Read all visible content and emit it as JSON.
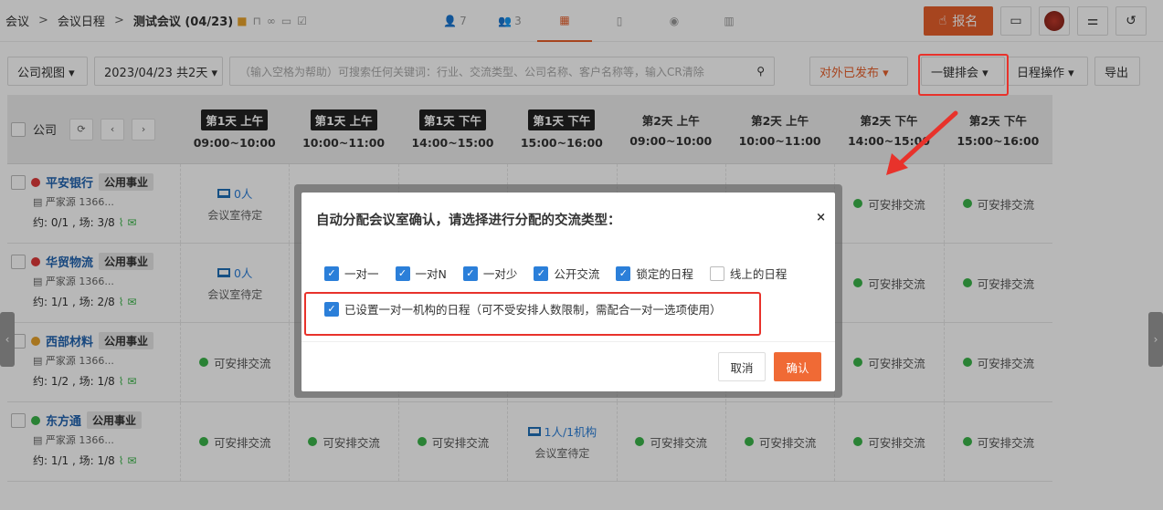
{
  "breadcrumb": {
    "items": [
      "会议",
      "会议日程",
      "测试会议 (04/23)"
    ]
  },
  "nav_tabs": [
    {
      "icon": "person-icon",
      "count": "7"
    },
    {
      "icon": "group-icon",
      "count": "3"
    },
    {
      "icon": "calendar-icon",
      "count": ""
    },
    {
      "icon": "document-icon",
      "count": ""
    },
    {
      "icon": "location-icon",
      "count": ""
    },
    {
      "icon": "chart-icon",
      "count": ""
    }
  ],
  "header": {
    "signup_label": "报名"
  },
  "filters": {
    "company_view": "公司视图 ▾",
    "date_range": "2023/04/23 共2天 ▾",
    "search_placeholder": "（输入空格为帮助）可搜索任何关键词：行业、交流类型、公司名称、客户名称等，输入CR清除",
    "published": "对外已发布 ▾",
    "auto_arrange": "一键排会 ▾",
    "schedule_ops": "日程操作 ▾",
    "export": "导出"
  },
  "grid": {
    "company_header": "公司",
    "slots": [
      {
        "day": "第1天 上午",
        "time": "09:00~10:00",
        "dark": true
      },
      {
        "day": "第1天 上午",
        "time": "10:00~11:00",
        "dark": true
      },
      {
        "day": "第1天 下午",
        "time": "14:00~15:00",
        "dark": true
      },
      {
        "day": "第1天 下午",
        "time": "15:00~16:00",
        "dark": true
      },
      {
        "day": "第2天 上午",
        "time": "09:00~10:00",
        "dark": false
      },
      {
        "day": "第2天 上午",
        "time": "10:00~11:00",
        "dark": false
      },
      {
        "day": "第2天 下午",
        "time": "14:00~15:00",
        "dark": false
      },
      {
        "day": "第2天 下午",
        "time": "15:00~16:00",
        "dark": false
      }
    ],
    "rows": [
      {
        "name": "平安银行",
        "tag": "公用事业",
        "contact": "严家源 1366...",
        "stats": "约: 0/1 , 场: 3/8",
        "status_color": "#e03a3a",
        "cells": [
          {
            "kind": "room",
            "top": "0人",
            "sub": "会议室待定"
          },
          {
            "kind": "blank"
          },
          {
            "kind": "blank"
          },
          {
            "kind": "blank"
          },
          {
            "kind": "blank"
          },
          {
            "kind": "blank"
          },
          {
            "kind": "avail",
            "text": "可安排交流"
          },
          {
            "kind": "avail",
            "text": "可安排交流"
          }
        ]
      },
      {
        "name": "华贸物流",
        "tag": "公用事业",
        "contact": "严家源 1366...",
        "stats": "约: 1/1 , 场: 2/8",
        "status_color": "#e03a3a",
        "cells": [
          {
            "kind": "room",
            "top": "0人",
            "sub": "会议室待定"
          },
          {
            "kind": "blank"
          },
          {
            "kind": "blank"
          },
          {
            "kind": "blank"
          },
          {
            "kind": "blank"
          },
          {
            "kind": "blank"
          },
          {
            "kind": "avail",
            "text": "可安排交流"
          },
          {
            "kind": "avail",
            "text": "可安排交流"
          }
        ]
      },
      {
        "name": "西部材料",
        "tag": "公用事业",
        "contact": "严家源 1366...",
        "stats": "约: 1/2 , 场: 1/8",
        "status_color": "#e8a32c",
        "cells": [
          {
            "kind": "avail",
            "text": "可安排交流"
          },
          {
            "kind": "blank"
          },
          {
            "kind": "blank"
          },
          {
            "kind": "blank"
          },
          {
            "kind": "blank"
          },
          {
            "kind": "blank"
          },
          {
            "kind": "avail",
            "text": "可安排交流"
          },
          {
            "kind": "avail",
            "text": "可安排交流"
          }
        ]
      },
      {
        "name": "东方通",
        "tag": "公用事业",
        "contact": "严家源 1366...",
        "stats": "约: 1/1 , 场: 1/8",
        "status_color": "#3bb54a",
        "cells": [
          {
            "kind": "avail",
            "text": "可安排交流"
          },
          {
            "kind": "avail",
            "text": "可安排交流"
          },
          {
            "kind": "avail",
            "text": "可安排交流"
          },
          {
            "kind": "room",
            "top": "1人/1机构",
            "sub": "会议室待定"
          },
          {
            "kind": "avail",
            "text": "可安排交流"
          },
          {
            "kind": "avail",
            "text": "可安排交流"
          },
          {
            "kind": "avail",
            "text": "可安排交流"
          },
          {
            "kind": "avail",
            "text": "可安排交流"
          }
        ]
      }
    ]
  },
  "modal": {
    "title": "自动分配会议室确认，请选择进行分配的交流类型：",
    "close": "×",
    "options": [
      {
        "label": "一对一",
        "checked": true
      },
      {
        "label": "一对N",
        "checked": true
      },
      {
        "label": "一对少",
        "checked": true
      },
      {
        "label": "公开交流",
        "checked": true
      },
      {
        "label": "锁定的日程",
        "checked": true
      },
      {
        "label": "线上的日程",
        "checked": false
      }
    ],
    "extra_option": {
      "label": "已设置一对一机构的日程（可不受安排人数限制，需配合一对一选项使用）",
      "checked": true
    },
    "cancel": "取消",
    "confirm": "确认"
  },
  "colors": {
    "accent": "#e8602c",
    "annotation": "#e8322b",
    "link": "#2264b0",
    "check": "#2b7fd9"
  }
}
